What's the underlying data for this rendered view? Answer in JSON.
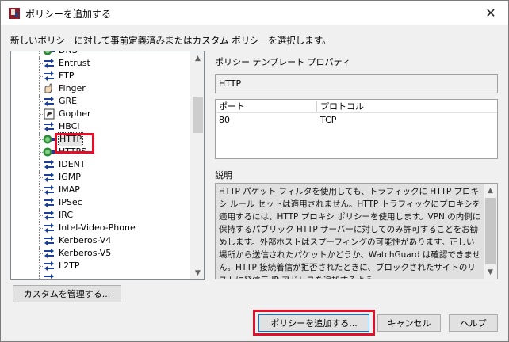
{
  "window": {
    "title": "ポリシーを追加する",
    "close_symbol": "✕"
  },
  "instruction": "新しいポリシーに対して事前定義済みまたはカスタム ポリシーを選択します。",
  "tree": {
    "items": [
      {
        "label": "DNS",
        "icon": "proxy-policy-icon"
      },
      {
        "label": "Entrust",
        "icon": "packet-filter-icon"
      },
      {
        "label": "FTP",
        "icon": "packet-filter-icon"
      },
      {
        "label": "Finger",
        "icon": "finger-icon"
      },
      {
        "label": "GRE",
        "icon": "packet-filter-icon"
      },
      {
        "label": "Gopher",
        "icon": "gopher-icon"
      },
      {
        "label": "HBCI",
        "icon": "packet-filter-icon"
      },
      {
        "label": "HTTP",
        "icon": "proxy-policy-icon",
        "selected": true
      },
      {
        "label": "HTTPS",
        "icon": "proxy-policy-icon"
      },
      {
        "label": "IDENT",
        "icon": "packet-filter-icon"
      },
      {
        "label": "IGMP",
        "icon": "packet-filter-icon"
      },
      {
        "label": "IMAP",
        "icon": "packet-filter-icon"
      },
      {
        "label": "IPSec",
        "icon": "packet-filter-icon"
      },
      {
        "label": "IRC",
        "icon": "packet-filter-icon"
      },
      {
        "label": "Intel-Video-Phone",
        "icon": "packet-filter-icon"
      },
      {
        "label": "Kerberos-V4",
        "icon": "packet-filter-icon"
      },
      {
        "label": "Kerberos-V5",
        "icon": "packet-filter-icon"
      },
      {
        "label": "L2TP",
        "icon": "packet-filter-icon"
      },
      {
        "label": "",
        "icon": "packet-filter-icon"
      }
    ],
    "scroll_up": "▲",
    "scroll_down": "▼"
  },
  "properties": {
    "heading": "ポリシー テンプレート プロパティ",
    "template_name": "HTTP",
    "columns": [
      "ポート",
      "プロトコル"
    ],
    "rows": [
      [
        "80",
        "TCP"
      ]
    ]
  },
  "description": {
    "heading": "説明",
    "text": "HTTP パケット フィルタを使用しても、トラフィックに HTTP プロキシ ルール セットは適用されません。HTTP トラフィックにプロキシを適用するには、HTTP プロキシ ポリシーを使用します。VPN の内側に保持するパブリック HTTP サーバーに対してのみ許可することをお勧めします。外部ホストはスプーフィングの可能性があります。正しい場所から送信されたパケットかどうか、WatchGuard は確認できません。HTTP 接続着信が拒否されたときに、ブロックされたサイトのリストに発信元 IP アドレスを追加するよう"
  },
  "buttons": {
    "manage_custom": "カスタムを管理する...",
    "add_policy": "ポリシーを追加する...",
    "cancel": "キャンセル",
    "help": "ヘルプ"
  },
  "colors": {
    "highlight_frame": "#e0102a",
    "dialog_bg": "#f0f0f0"
  }
}
